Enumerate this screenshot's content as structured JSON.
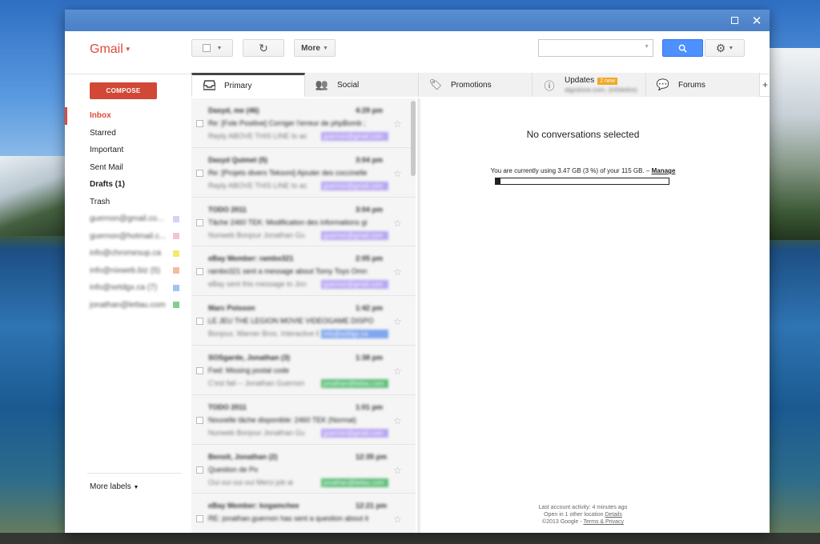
{
  "app": {
    "logo": "Gmail"
  },
  "toolbar": {
    "more_label": "More",
    "search_placeholder": ""
  },
  "compose_label": "COMPOSE",
  "nav": [
    {
      "label": "Inbox",
      "style": "active"
    },
    {
      "label": "Starred",
      "style": ""
    },
    {
      "label": "Important",
      "style": ""
    },
    {
      "label": "Sent Mail",
      "style": ""
    },
    {
      "label": "Drafts (1)",
      "style": "bold"
    },
    {
      "label": "Trash",
      "style": ""
    },
    {
      "label": "guernon@gmail.co...",
      "style": "blurred",
      "color": "#d7d1f7"
    },
    {
      "label": "guernon@hotmail.c...",
      "style": "blurred",
      "color": "#f7c3d0"
    },
    {
      "label": "info@chromesup.ca",
      "style": "blurred",
      "color": "#f7ea6b"
    },
    {
      "label": "info@nixweb.biz (5)",
      "style": "blurred",
      "color": "#f7b9a0"
    },
    {
      "label": "info@setdgx.ca (7)",
      "style": "blurred",
      "color": "#9fc3f3"
    },
    {
      "label": "jonathan@lettau.com",
      "style": "blurred",
      "color": "#7fcf92"
    }
  ],
  "more_labels": "More labels",
  "tabs": [
    {
      "label": "Primary",
      "icon": "inbox-icon"
    },
    {
      "label": "Social",
      "icon": "people-icon"
    },
    {
      "label": "Promotions",
      "icon": "tag-icon"
    },
    {
      "label": "Updates",
      "icon": "info-icon",
      "badge": "2 new",
      "sub": "algodone.com, (infolettre)"
    },
    {
      "label": "Forums",
      "icon": "chat-icon"
    }
  ],
  "emails": [
    {
      "from": "Dasyd, me (46)",
      "time": "4:29 pm",
      "subject": "Re: [Fole Positive] Corriger l'erreur de phpBomb ;",
      "snippet": "Reply ABOVE THIS LINE to ac",
      "tag": "guernon@gmail.com",
      "tag_color": "#b9a7f3"
    },
    {
      "from": "Dasyd Quimet (5)",
      "time": "3:04 pm",
      "subject": "Re: [Projets divers Teksoni] Ajouter des coccinelle",
      "snippet": "Reply ABOVE THIS LINE to ac",
      "tag": "guernon@gmail.com",
      "tag_color": "#b9a7f3"
    },
    {
      "from": "TODO 2011",
      "time": "3:04 pm",
      "subject": "Tâche 2460 TEK: Modification des informations gi",
      "snippet": "Nunweb Bonjour Jonathan Gu",
      "tag": "guernon@gmail.com",
      "tag_color": "#b9a7f3"
    },
    {
      "from": "eBay Member: rambo321",
      "time": "2:05 pm",
      "subject": "rambo321 sent a message about Tomy Toys Omn",
      "snippet": "eBay sent this message to Jon",
      "tag": "guernon@gmail.com",
      "tag_color": "#b9a7f3"
    },
    {
      "from": "Marc Poisson",
      "time": "1:42 pm",
      "subject": "LE JEU THE LEGION MOVIE VIDEOGAME DISPO",
      "snippet": "Bonjour, Warner Bros. Interactive E",
      "tag": "info@sofdgx.ca",
      "tag_color": "#7fa6ee"
    },
    {
      "from": "SOSgarde, Jonathan (3)",
      "time": "1:38 pm",
      "subject": "Fwd: Missing postal code",
      "snippet": "C'est fait -- Jonathan Guernon",
      "tag": "jonathan@lettau.com",
      "tag_color": "#5dbf7a"
    },
    {
      "from": "TODO 2011",
      "time": "1:01 pm",
      "subject": "Nouvelle tâche disponible: 2460 TEK (Normal)",
      "snippet": "Nunweb Bonjour Jonathan Gu",
      "tag": "guernon@gmail.com",
      "tag_color": "#b9a7f3"
    },
    {
      "from": "Benoit, Jonathan (2)",
      "time": "12:35 pm",
      "subject": "Question de Po",
      "snippet": "Oui oui oui oui Merci job ai",
      "tag": "jonathan@lettau.com",
      "tag_color": "#5dbf7a"
    },
    {
      "from": "eBay Member: kogamchee",
      "time": "12:21 pm",
      "subject": "RE: jonathan.guernon has sent a question about it",
      "snippet": "",
      "tag": "",
      "tag_color": "#b9a7f3"
    }
  ],
  "reading": {
    "no_conv": "No conversations selected",
    "usage_text": "You are currently using 3.47 GB (3 %) of your 115 GB. –",
    "manage": "Manage",
    "usage_fraction": 0.03
  },
  "footer": {
    "line1": "Last account activity: 4 minutes ago",
    "line2": "Open in 1 other location",
    "details": "Details",
    "line3": "©2013 Google -",
    "terms": "Terms & Privacy"
  }
}
